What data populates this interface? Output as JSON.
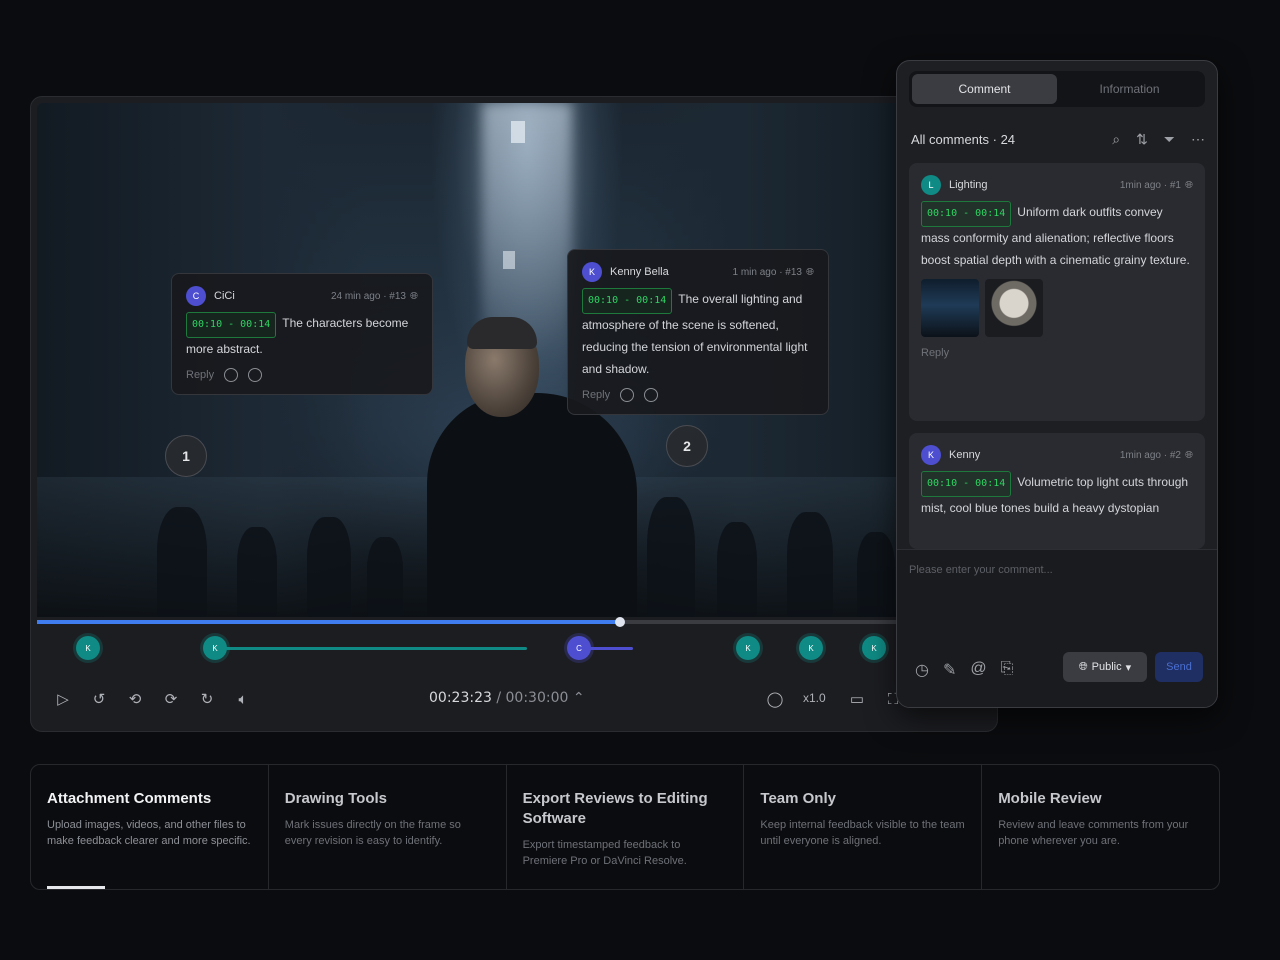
{
  "video": {
    "bubbles": [
      {
        "avatar": "C",
        "author": "CiCi",
        "meta": "24 min ago · #13",
        "timecode": "00:10 - 00:14",
        "text": "The characters become more abstract.",
        "reply": "Reply"
      },
      {
        "avatar": "K",
        "author": "Kenny Bella",
        "meta": "1 min ago · #13",
        "timecode": "00:10 - 00:14",
        "text": "The overall lighting and atmosphere of the scene is softened, reducing the tension of environmental light and shadow.",
        "reply": "Reply"
      }
    ],
    "markers": [
      "1",
      "2"
    ],
    "progress_fraction": 0.61
  },
  "timeline": {
    "dots": [
      {
        "label": "K",
        "color": "teal"
      },
      {
        "label": "K",
        "color": "teal"
      },
      {
        "label": "C",
        "color": "blue"
      },
      {
        "label": "K",
        "color": "teal"
      },
      {
        "label": "K",
        "color": "teal"
      },
      {
        "label": "K",
        "color": "teal"
      }
    ]
  },
  "controls": {
    "current_time": "00:23:23",
    "separator": " / ",
    "duration": "00:30:00",
    "speed": "x1.0",
    "icons": [
      "play-icon",
      "rewind-10-icon",
      "loop-icon",
      "repeat-icon",
      "forward-icon",
      "mute-icon",
      "comment-icon",
      "subtitle-icon",
      "fullscreen-icon"
    ]
  },
  "panel": {
    "tabs": [
      "Comment",
      "Information"
    ],
    "list_title": "All comments · 24",
    "tool_icons": [
      "search-icon",
      "sort-icon",
      "filter-icon",
      "more-icon"
    ],
    "comments": [
      {
        "avatar": "L",
        "author": "Lighting",
        "meta": "1min ago · #1",
        "timecode": "00:10 - 00:14",
        "text": "Uniform dark outfits convey mass conformity and alienation; reflective floors boost spatial depth with a cinematic grainy texture.",
        "reply": "Reply"
      },
      {
        "avatar": "K",
        "author": "Kenny",
        "meta": "1min ago · #2",
        "timecode": "00:10 - 00:14",
        "text": "Volumetric top light cuts through mist, cool blue tones build a heavy dystopian"
      }
    ],
    "composer": {
      "placeholder": "Please enter your comment...",
      "visibility": "Public",
      "send": "Send"
    }
  },
  "features": [
    {
      "title": "Attachment Comments",
      "desc": "Upload images, videos, and other files to make feedback clearer and more specific.",
      "active": true
    },
    {
      "title": "Drawing Tools",
      "desc": "Mark issues directly on the frame so every revision is easy to identify."
    },
    {
      "title": "Export Reviews to Editing Software",
      "desc": "Export timestamped feedback to Premiere Pro or DaVinci Resolve."
    },
    {
      "title": "Team Only",
      "desc": "Keep internal feedback visible to the team until everyone is aligned."
    },
    {
      "title": "Mobile Review",
      "desc": "Review and leave comments from your phone wherever you are."
    }
  ],
  "colors": {
    "accent_blue": "#3f7cf0",
    "timecode_green": "#2fd463",
    "teal": "#0f8a84",
    "purple": "#4d4fd0"
  }
}
